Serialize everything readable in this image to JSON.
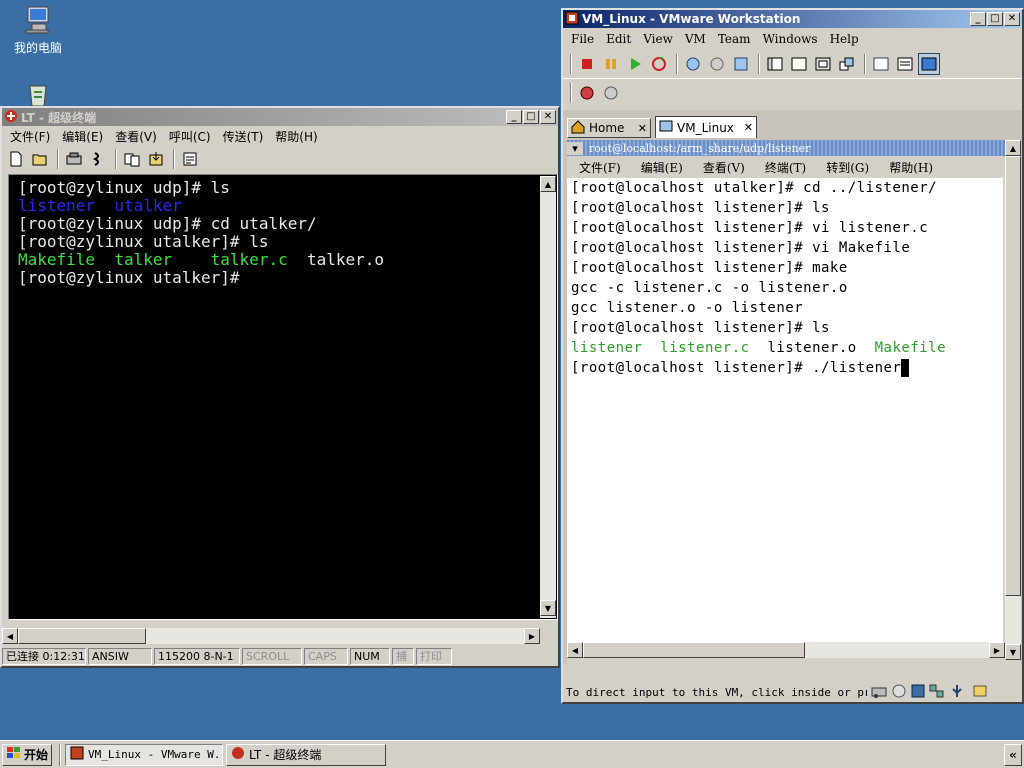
{
  "desktop": {
    "my_computer_label": "我的电脑"
  },
  "left_window": {
    "title": "LT - 超级终端",
    "menu": [
      "文件(F)",
      "编辑(E)",
      "查看(V)",
      "呼叫(C)",
      "传送(T)",
      "帮助(H)"
    ],
    "terminal_lines": [
      [
        {
          "t": "[root@zylinux udp]# ls",
          "c": "#e8e8e8"
        }
      ],
      [
        {
          "t": "listener",
          "c": "#2828e8"
        },
        {
          "t": "  ",
          "c": "#e8e8e8"
        },
        {
          "t": "utalker",
          "c": "#2828e8"
        }
      ],
      [
        {
          "t": "[root@zylinux udp]# cd utalker/",
          "c": "#e8e8e8"
        }
      ],
      [
        {
          "t": "[root@zylinux utalker]# ls",
          "c": "#e8e8e8"
        }
      ],
      [
        {
          "t": "Makefile",
          "c": "#3ce03c"
        },
        {
          "t": "  ",
          "c": "#e8e8e8"
        },
        {
          "t": "talker",
          "c": "#3ce03c"
        },
        {
          "t": "    ",
          "c": "#e8e8e8"
        },
        {
          "t": "talker.c",
          "c": "#3ce03c"
        },
        {
          "t": "  talker.o",
          "c": "#e8e8e8"
        }
      ],
      [
        {
          "t": "[root@zylinux utalker]# ",
          "c": "#e8e8e8"
        }
      ]
    ],
    "status": {
      "connected": "已连接 0:12:31",
      "emulation": "ANSIW",
      "port": "115200 8-N-1",
      "scroll": "SCROLL",
      "caps": "CAPS",
      "num": "NUM",
      "capture": "捕",
      "print": "打印"
    }
  },
  "right_window": {
    "title": "VM_Linux - VMware Workstation",
    "menu": [
      "File",
      "Edit",
      "View",
      "VM",
      "Team",
      "Windows",
      "Help"
    ],
    "tabs": {
      "home": "Home",
      "vm": "VM_Linux"
    },
    "guest_title": "root@localhost:/arm_share/udp/listener",
    "guest_menu": [
      "文件(F)",
      "编辑(E)",
      "查看(V)",
      "终端(T)",
      "转到(G)",
      "帮助(H)"
    ],
    "terminal_lines": [
      [
        {
          "t": "[root@localhost utalker]# cd ../listener/",
          "c": "#000"
        }
      ],
      [
        {
          "t": "[root@localhost listener]# ls",
          "c": "#000"
        }
      ],
      [
        {
          "t": "[root@localhost listener]# vi listener.c",
          "c": "#000"
        }
      ],
      [
        {
          "t": "[root@localhost listener]# vi Makefile",
          "c": "#000"
        }
      ],
      [
        {
          "t": "[root@localhost listener]# make",
          "c": "#000"
        }
      ],
      [
        {
          "t": "gcc -c listener.c -o listener.o",
          "c": "#000"
        }
      ],
      [
        {
          "t": "gcc listener.o -o listener",
          "c": "#000"
        }
      ],
      [
        {
          "t": "[root@localhost listener]# ls",
          "c": "#000"
        }
      ],
      [
        {
          "t": "listener",
          "c": "#2aa02a"
        },
        {
          "t": "  ",
          "c": "#000"
        },
        {
          "t": "listener.c",
          "c": "#2aa02a"
        },
        {
          "t": "  listener.o  ",
          "c": "#000"
        },
        {
          "t": "Makefile",
          "c": "#2aa02a"
        }
      ],
      [
        {
          "t": "[root@localhost listener]# ./listener",
          "c": "#000"
        }
      ]
    ],
    "status_text": "To direct input to this VM, click inside or press Ctrl+G."
  },
  "taskbar": {
    "start": "开始",
    "tasks": [
      "VM_Linux - VMware W...",
      "LT - 超级终端"
    ]
  }
}
